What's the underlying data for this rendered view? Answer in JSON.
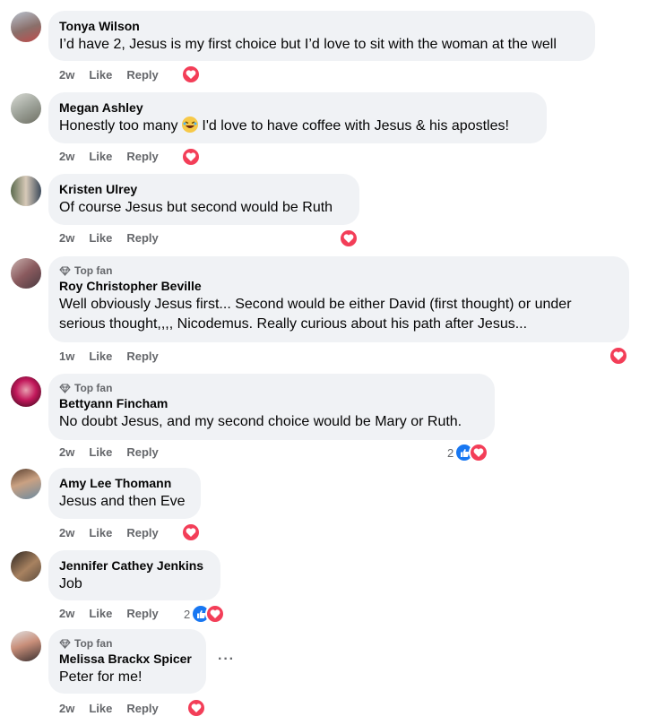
{
  "labels": {
    "like": "Like",
    "reply": "Reply",
    "top_fan": "Top fan",
    "more": "···"
  },
  "colors": {
    "bubble": "#f0f2f5",
    "meta": "#65676b",
    "love": "#f33e58",
    "like": "#1877f2"
  },
  "comments": [
    {
      "name": "Tonya Wilson",
      "text": "I’d have 2, Jesus is my first choice but I’d love to sit with the woman at the well",
      "time": "2w",
      "reactions": [
        "love"
      ],
      "count": ""
    },
    {
      "name": "Megan Ashley",
      "text_before": "Honestly too many",
      "emoji": "laughing-emoji",
      "text_after": "I'd love to have coffee with Jesus & his apostles!",
      "time": "2w",
      "reactions": [
        "love"
      ],
      "count": ""
    },
    {
      "name": "Kristen Ulrey",
      "text": "Of course Jesus but second would be Ruth",
      "time": "2w",
      "reactions": [
        "love"
      ],
      "count": ""
    },
    {
      "name": "Roy Christopher Beville",
      "top_fan": true,
      "text": "Well obviously Jesus first... Second would be either David (first thought) or under serious thought,,,, Nicodemus. Really curious about his path after Jesus...",
      "time": "1w",
      "reactions": [
        "love"
      ],
      "count": ""
    },
    {
      "name": "Bettyann Fincham",
      "top_fan": true,
      "text": "No doubt Jesus, and my second choice would be Mary or Ruth.",
      "time": "2w",
      "reactions": [
        "like",
        "love"
      ],
      "count": "2"
    },
    {
      "name": "Amy Lee Thomann",
      "text": "Jesus and then Eve",
      "time": "2w",
      "reactions": [
        "love"
      ],
      "count": ""
    },
    {
      "name": "Jennifer Cathey Jenkins",
      "text": "Job",
      "time": "2w",
      "reactions": [
        "like",
        "love"
      ],
      "count": "2"
    },
    {
      "name": "Melissa Brackx Spicer",
      "top_fan": true,
      "text": "Peter for me!",
      "time": "2w",
      "reactions": [
        "love"
      ],
      "count": ""
    }
  ]
}
